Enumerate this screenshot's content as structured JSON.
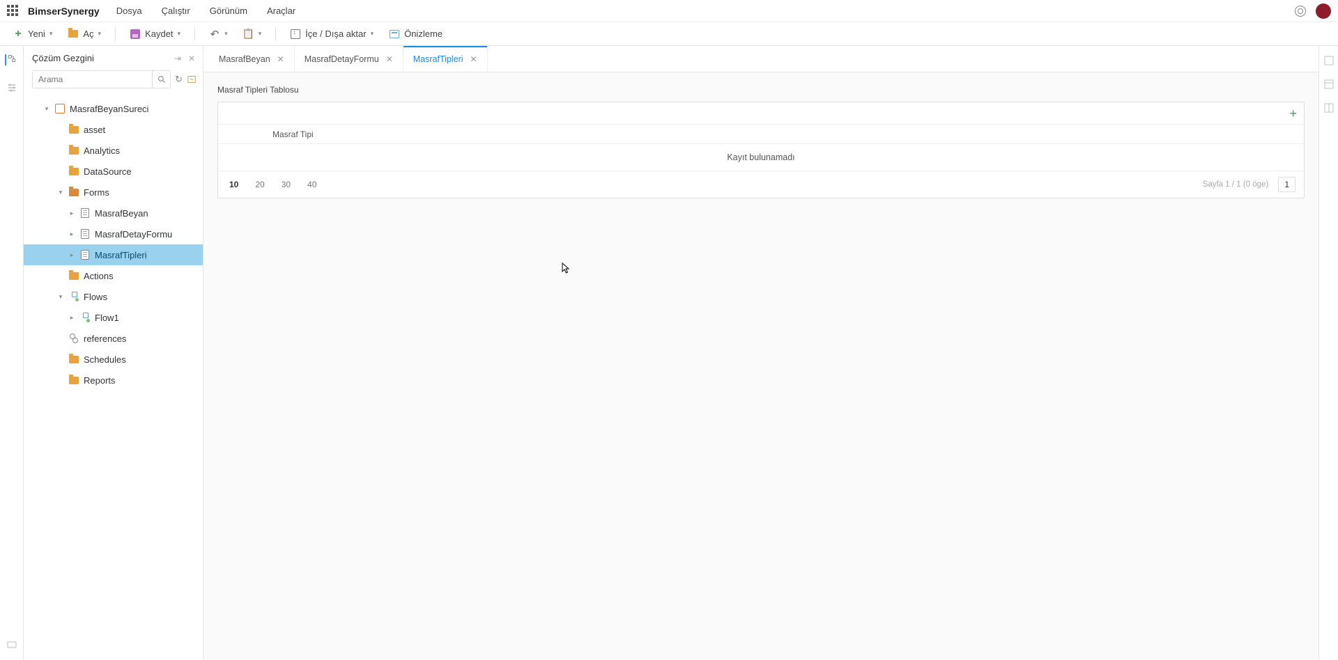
{
  "brand": "BimserSynergy",
  "menu": [
    "Dosya",
    "Çalıştır",
    "Görünüm",
    "Araçlar"
  ],
  "toolbar": {
    "new": "Yeni",
    "open": "Aç",
    "save": "Kaydet",
    "import_export": "İçe / Dışa aktar",
    "preview": "Önizleme"
  },
  "sidebar": {
    "title": "Çözüm Gezgini",
    "search_placeholder": "Arama",
    "tree": {
      "project": "MasrafBeyanSureci",
      "nodes": {
        "asset": "asset",
        "analytics": "Analytics",
        "datasource": "DataSource",
        "forms": "Forms",
        "form1": "MasrafBeyan",
        "form2": "MasrafDetayFormu",
        "form3": "MasrafTipleri",
        "actions": "Actions",
        "flows": "Flows",
        "flow1": "Flow1",
        "references": "references",
        "schedules": "Schedules",
        "reports": "Reports"
      }
    }
  },
  "tabs": [
    {
      "label": "MasrafBeyan",
      "active": false
    },
    {
      "label": "MasrafDetayFormu",
      "active": false
    },
    {
      "label": "MasrafTipleri",
      "active": true
    }
  ],
  "form": {
    "title": "Masraf Tipleri Tablosu",
    "column": "Masraf Tipi",
    "empty": "Kayıt bulunamadı",
    "page_sizes": [
      "10",
      "20",
      "30",
      "40"
    ],
    "page_info": "Sayfa 1 / 1 (0 öge)",
    "page_current": "1"
  }
}
